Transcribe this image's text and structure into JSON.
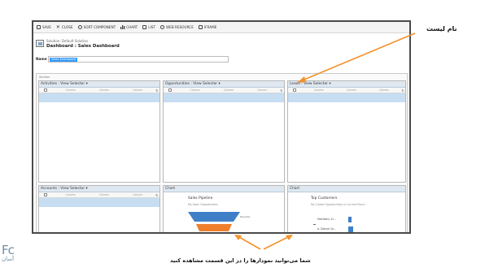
{
  "toolbar": {
    "items": [
      {
        "label": "SAVE",
        "icon": "save-icon"
      },
      {
        "label": "CLOSE",
        "icon": "close-icon"
      },
      {
        "label": "SORT COMPONENT",
        "icon": "sort-icon"
      },
      {
        "label": "CHART",
        "icon": "chart-icon"
      },
      {
        "label": "LIST",
        "icon": "list-icon"
      },
      {
        "label": "WEB RESOURCE",
        "icon": "web-resource-icon"
      },
      {
        "label": "IFRAME",
        "icon": "iframe-icon"
      }
    ]
  },
  "header": {
    "solution": "Solution: Default Solution",
    "title": "Dashboard : Sales Dashboard"
  },
  "name_field": {
    "label": "Name",
    "value": "Sales Dashboard"
  },
  "section_label": "Section",
  "panels": [
    {
      "title": "Activities : View Selector"
    },
    {
      "title": "Opportunities : View Selector"
    },
    {
      "title": "Leads : View Selector"
    },
    {
      "title": "Accounts : View Selector"
    },
    {
      "title": "Chart",
      "chart_title": "Sales Pipeline",
      "chart_sub": "My Open Opportunities",
      "chart_label": "Develop"
    },
    {
      "title": "Chart",
      "chart_title": "Top Customers",
      "chart_sub": "My Closed Opportunities in Current Fiscal...",
      "bar_labels": [
        "Fabrikam, In...",
        "A. Datum Co..."
      ]
    }
  ],
  "grid_columns": [
    "Column",
    "Column",
    "Column"
  ],
  "annotations": {
    "top": "نام لیست",
    "bottom": "شما می‌توانید نمودارها را در این قسمت مشاهده کنید"
  },
  "logo": {
    "main": "Fc",
    "sub": "آسان"
  },
  "colors": {
    "arrow": "#f5912a",
    "funnel_blue": "#3f7fc8",
    "funnel_orange": "#f07f2b",
    "header_blue": "#dfe8f1",
    "selection_blue": "#c7ddf2"
  }
}
